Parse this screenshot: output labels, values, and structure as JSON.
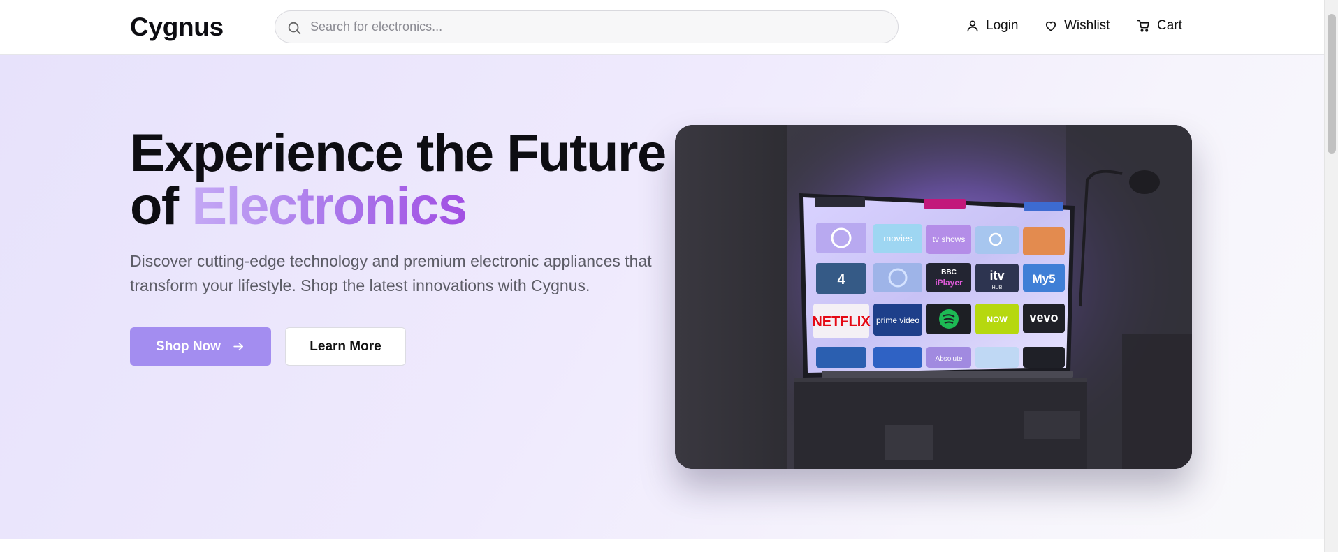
{
  "header": {
    "logo": "Cygnus",
    "search_placeholder": "Search for electronics...",
    "nav": {
      "login": "Login",
      "wishlist": "Wishlist",
      "cart": "Cart"
    }
  },
  "hero": {
    "title_line1": "Experience the Future",
    "title_line2_prefix": "of ",
    "title_line2_accent": "Electronics",
    "subtitle": "Discover cutting-edge technology and premium electronic appliances that transform your lifestyle. Shop the latest innovations with Cygnus.",
    "primary_button": "Shop Now",
    "secondary_button": "Learn More"
  },
  "tv_apps": {
    "movies": "movies",
    "tv_shows": "tv shows",
    "channel4": "4",
    "bbc": "BBC",
    "iplayer": "iPlayer",
    "itv": "itv",
    "itv_hub": "HUB",
    "my5": "My5",
    "netflix": "NETFLIX",
    "prime": "prime video",
    "now": "NOW",
    "vevo": "vevo",
    "absolute": "Absolute"
  },
  "colors": {
    "accent": "#a38df0",
    "accent_gradient_start": "#c4a9f5",
    "accent_gradient_end": "#a24fe3",
    "hero_bg": "#efeafd",
    "netflix_red": "#e50914",
    "spotify_green": "#1db954",
    "now_lime": "#b6d80f"
  },
  "icons": {
    "search": "search-icon",
    "login": "user-icon",
    "wishlist": "heart-icon",
    "cart": "cart-icon",
    "shop_now": "arrow-right-icon"
  }
}
